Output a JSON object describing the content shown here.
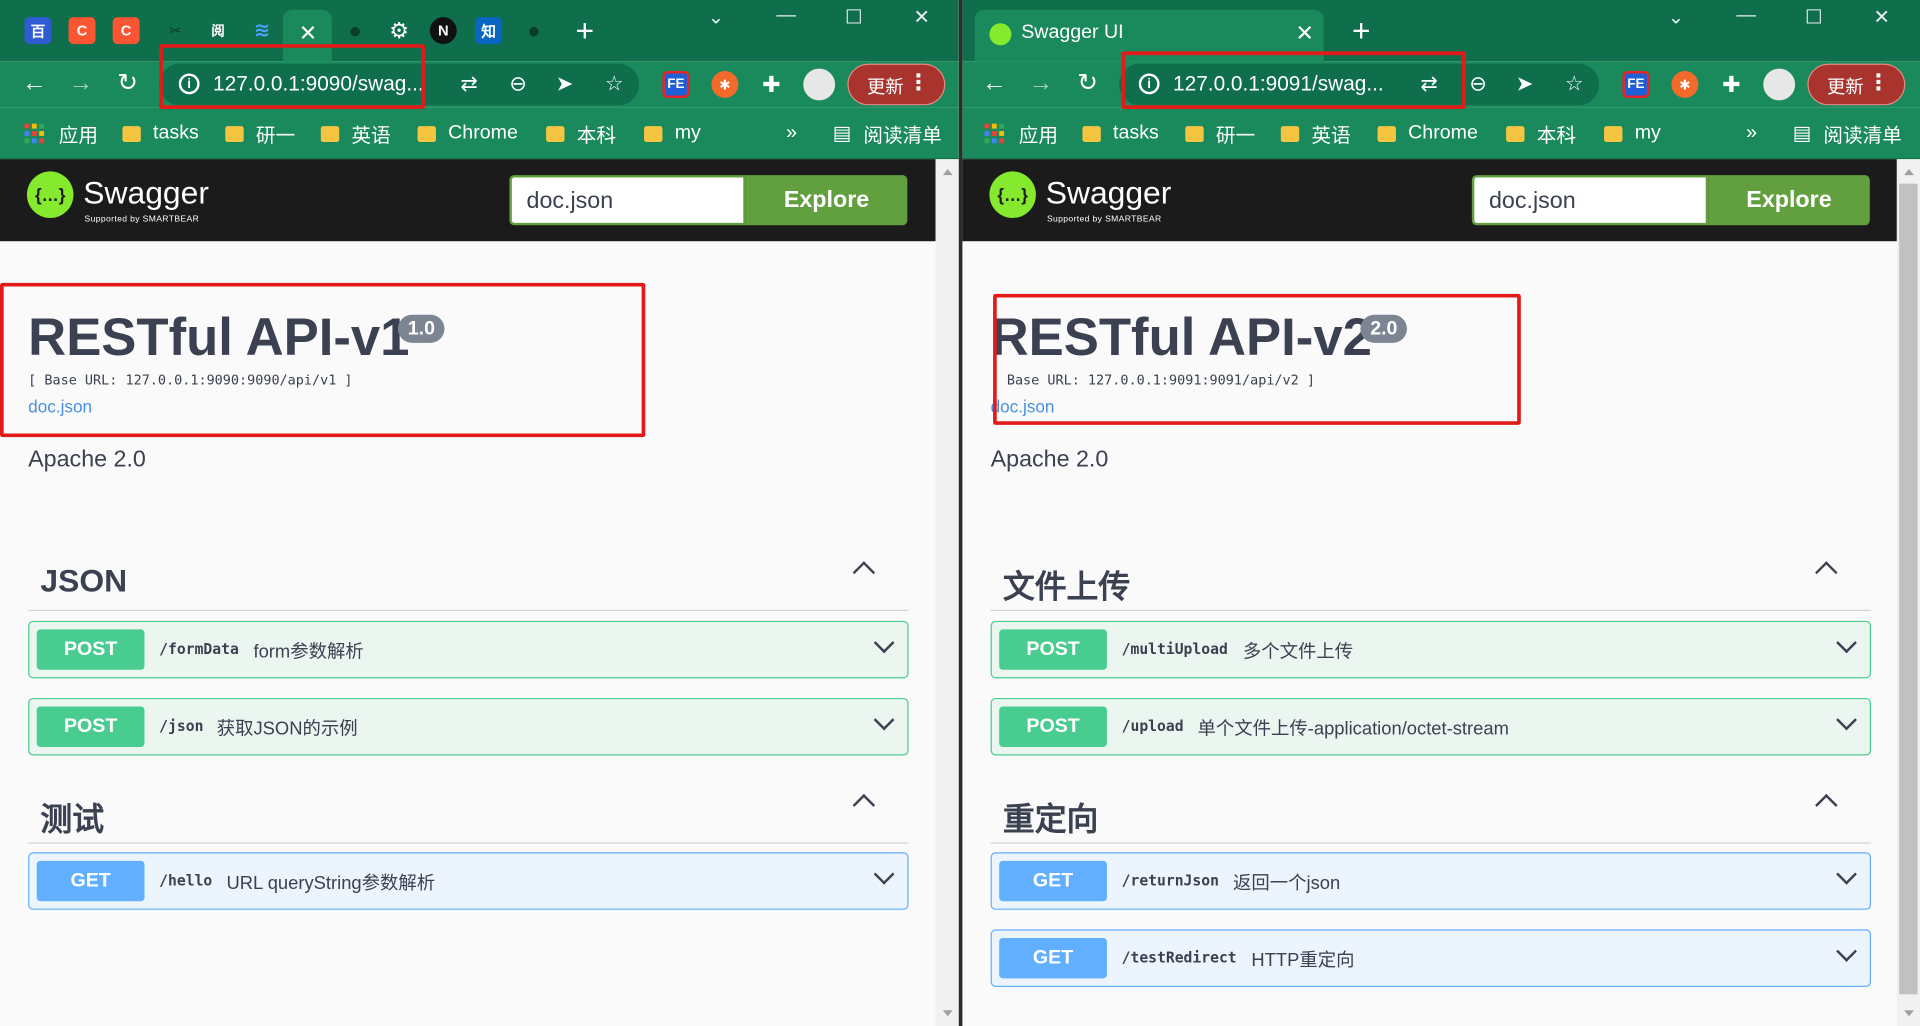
{
  "left": {
    "tab_icons": [
      "baidu-icon",
      "csdn-icon",
      "csdn-icon",
      "tool-icon",
      "reader-icon",
      "bookmark-icon",
      "active-tab",
      "github-icon",
      "gear-icon",
      "notion-icon",
      "zhihu-icon",
      "github-icon"
    ],
    "url": "127.0.0.1:9090/swag...",
    "update_label": "更新",
    "bookmarks": {
      "apps": "应用",
      "folders": [
        "tasks",
        "研一",
        "英语",
        "Chrome",
        "本科",
        "my"
      ],
      "more": "»",
      "reading_list": "阅读清单"
    },
    "swagger": {
      "brand": "Swagger",
      "brand_sub": "Supported by SMARTBEAR",
      "search_value": "doc.json",
      "explore_label": "Explore",
      "title": "RESTful API-v1",
      "version": "1.0",
      "base_url": "[ Base URL: 127.0.0.1:9090:9090/api/v1 ]",
      "doc_link": "doc.json",
      "license": "Apache 2.0",
      "tags": [
        {
          "name": "JSON",
          "ops": [
            {
              "method": "POST",
              "path": "/formData",
              "summary": "form参数解析"
            },
            {
              "method": "POST",
              "path": "/json",
              "summary": "获取JSON的示例"
            }
          ]
        },
        {
          "name": "测试",
          "ops": [
            {
              "method": "GET",
              "path": "/hello",
              "summary": "URL queryString参数解析"
            }
          ]
        }
      ]
    }
  },
  "right": {
    "tab_title": "Swagger UI",
    "url": "127.0.0.1:9091/swag...",
    "update_label": "更新",
    "bookmarks": {
      "apps": "应用",
      "folders": [
        "tasks",
        "研一",
        "英语",
        "Chrome",
        "本科",
        "my"
      ],
      "more": "»",
      "reading_list": "阅读清单"
    },
    "swagger": {
      "brand": "Swagger",
      "brand_sub": "Supported by SMARTBEAR",
      "search_value": "doc.json",
      "explore_label": "Explore",
      "title": "RESTful API-v2",
      "version": "2.0",
      "base_url": "[ Base URL: 127.0.0.1:9091:9091/api/v2 ]",
      "doc_link": "doc.json",
      "license": "Apache 2.0",
      "tags": [
        {
          "name": "文件上传",
          "ops": [
            {
              "method": "POST",
              "path": "/multiUpload",
              "summary": "多个文件上传"
            },
            {
              "method": "POST",
              "path": "/upload",
              "summary": "单个文件上传-application/octet-stream"
            }
          ]
        },
        {
          "name": "重定向",
          "ops": [
            {
              "method": "GET",
              "path": "/returnJson",
              "summary": "返回一个json"
            },
            {
              "method": "GET",
              "path": "/testRedirect",
              "summary": "HTTP重定向"
            }
          ]
        }
      ]
    }
  },
  "colors": {
    "chrome_dark": "#0f6e4b",
    "chrome": "#1a8a5c",
    "post": "#49cc90",
    "get": "#61affe",
    "explore": "#62a03f",
    "annotation": "#e31a1a"
  }
}
